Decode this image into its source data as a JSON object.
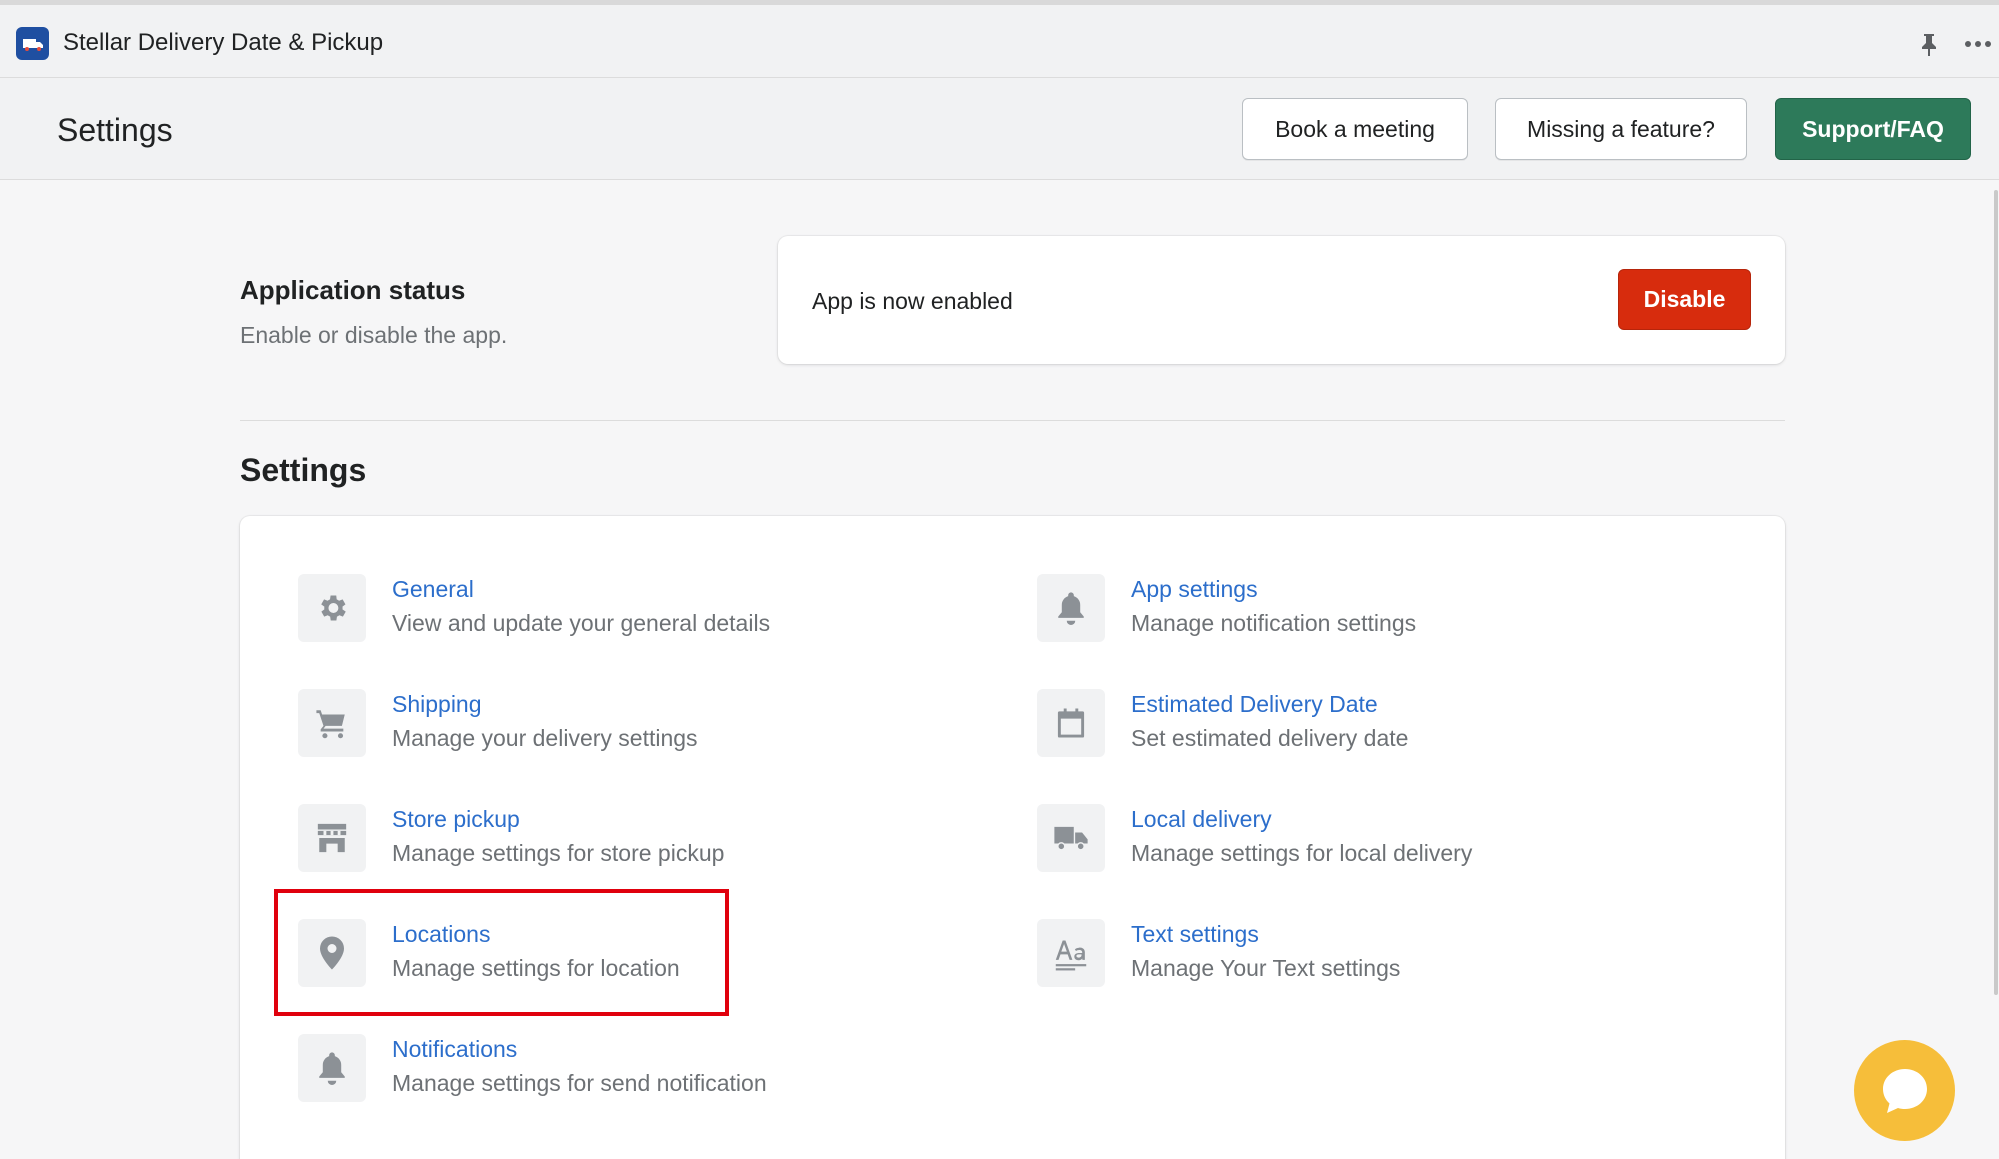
{
  "topbar": {
    "app_title": "Stellar Delivery Date & Pickup",
    "logo_icon": "truck-logo-icon",
    "pin_icon": "pin-icon",
    "more_icon": "more-horizontal-icon"
  },
  "header": {
    "title": "Settings",
    "buttons": {
      "book_meeting": "Book a meeting",
      "missing_feature": "Missing a feature?",
      "support": "Support/FAQ"
    }
  },
  "app_status": {
    "heading": "Application status",
    "description": "Enable or disable the app.",
    "status_text": "App is now enabled",
    "disable_label": "Disable"
  },
  "settings": {
    "heading": "Settings",
    "items": [
      {
        "title": "General",
        "description": "View and update your general details",
        "icon": "gear-icon"
      },
      {
        "title": "App settings",
        "description": "Manage notification settings",
        "icon": "bell-icon"
      },
      {
        "title": "Shipping",
        "description": "Manage your delivery settings",
        "icon": "cart-icon"
      },
      {
        "title": "Estimated Delivery Date",
        "description": "Set estimated delivery date",
        "icon": "calendar-icon"
      },
      {
        "title": "Store pickup",
        "description": "Manage settings for store pickup",
        "icon": "store-icon"
      },
      {
        "title": "Local delivery",
        "description": "Manage settings for local delivery",
        "icon": "truck-icon"
      },
      {
        "title": "Locations",
        "description": "Manage settings for location",
        "icon": "location-pin-icon"
      },
      {
        "title": "Text settings",
        "description": "Manage Your Text settings",
        "icon": "text-icon"
      },
      {
        "title": "Notifications",
        "description": "Manage settings for send notification",
        "icon": "bell-icon"
      }
    ]
  },
  "colors": {
    "link": "#2c6ecb",
    "primary": "#2d7a5a",
    "critical": "#d72c0d",
    "highlight": "#e0000d",
    "chat": "#f6be3a"
  },
  "chat": {
    "icon": "chat-icon"
  }
}
